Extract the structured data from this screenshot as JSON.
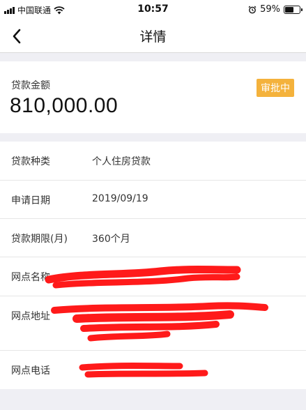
{
  "status_bar": {
    "carrier": "中国联通",
    "time": "10:57",
    "battery": "59%",
    "battery_level": 0.59
  },
  "nav": {
    "title": "详情"
  },
  "loan": {
    "amount_label": "贷款金额",
    "amount": "810,000.00",
    "status": "审批中"
  },
  "details": [
    {
      "label": "贷款种类",
      "value": "个人住房贷款"
    },
    {
      "label": "申请日期",
      "value": "2019/09/19"
    },
    {
      "label": "贷款期限(月)",
      "value": "360个月"
    },
    {
      "label": "网点名称",
      "value": ""
    },
    {
      "label": "网点地址",
      "value": ""
    },
    {
      "label": "网点电话",
      "value": ""
    }
  ],
  "colors": {
    "status_badge": "#f4b23c",
    "redaction": "#ff1a1a",
    "background": "#efeff4"
  }
}
